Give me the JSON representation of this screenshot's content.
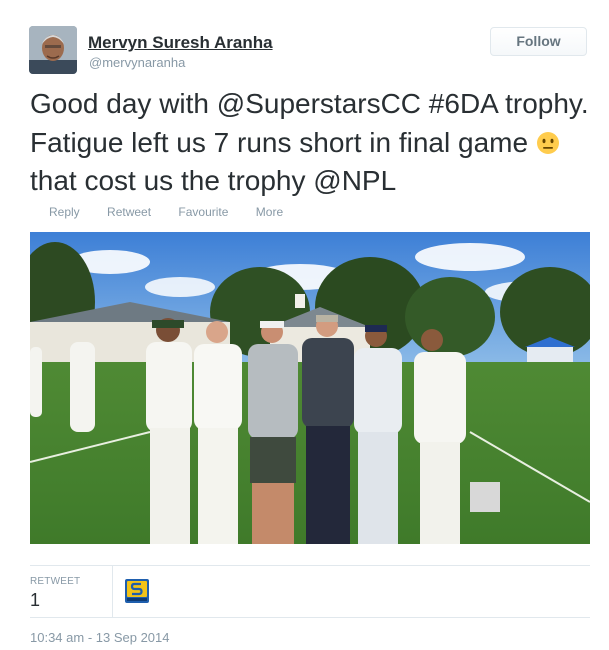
{
  "author": {
    "display_name": "Mervyn Suresh Aranha",
    "handle": "@mervynaranha",
    "avatar_icon": "profile-photo"
  },
  "follow_button": {
    "label": "Follow"
  },
  "tweet": {
    "text_before_emoji": "Good day with @SuperstarsCC #6DA trophy. Fatigue left us 7 runs short in final game ",
    "emoji_icon": "neutral-face-emoji",
    "text_after_emoji": " that cost us the trophy @NPL"
  },
  "actions": {
    "reply": "Reply",
    "retweet": "Retweet",
    "favourite": "Favourite",
    "more": "More"
  },
  "stats": {
    "retweet_label": "RETWEET",
    "retweet_count": "1",
    "retweeter_icon": "superstars-logo"
  },
  "timestamp": "10:34 am - 13 Sep 2014",
  "colors": {
    "text": "#292f33",
    "muted": "#8899a6",
    "border": "#e1e8ed",
    "emoji": "#ffcc4d"
  }
}
